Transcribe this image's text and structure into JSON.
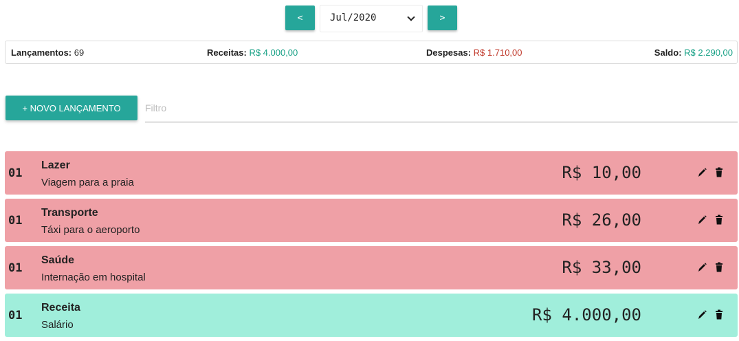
{
  "period": {
    "prev_label": "<",
    "next_label": ">",
    "selected": "Jul/2020"
  },
  "summary": {
    "count_label": "Lançamentos:",
    "count_value": "69",
    "income_label": "Receitas:",
    "income_value": "R$ 4.000,00",
    "expense_label": "Despesas:",
    "expense_value": "R$ 1.710,00",
    "balance_label": "Saldo:",
    "balance_value": "R$ 2.290,00"
  },
  "actions": {
    "new_label": "+ NOVO LANÇAMENTO",
    "filter_placeholder": "Filtro"
  },
  "colors": {
    "accent": "#26a69a",
    "expense_bg": "#efa0a6",
    "income_bg": "#a0eedb",
    "positive_text": "#16a085",
    "negative_text": "#c0392b"
  },
  "entries": [
    {
      "day": "01",
      "category": "Lazer",
      "description": "Viagem para a praia",
      "amount": "R$ 10,00",
      "kind": "expense"
    },
    {
      "day": "01",
      "category": "Transporte",
      "description": "Táxi para o aeroporto",
      "amount": "R$ 26,00",
      "kind": "expense"
    },
    {
      "day": "01",
      "category": "Saúde",
      "description": "Internação em hospital",
      "amount": "R$ 33,00",
      "kind": "expense"
    },
    {
      "day": "01",
      "category": "Receita",
      "description": "Salário",
      "amount": "R$ 4.000,00",
      "kind": "income"
    }
  ],
  "icons": {
    "edit": "pencil-icon",
    "delete": "trash-icon"
  }
}
